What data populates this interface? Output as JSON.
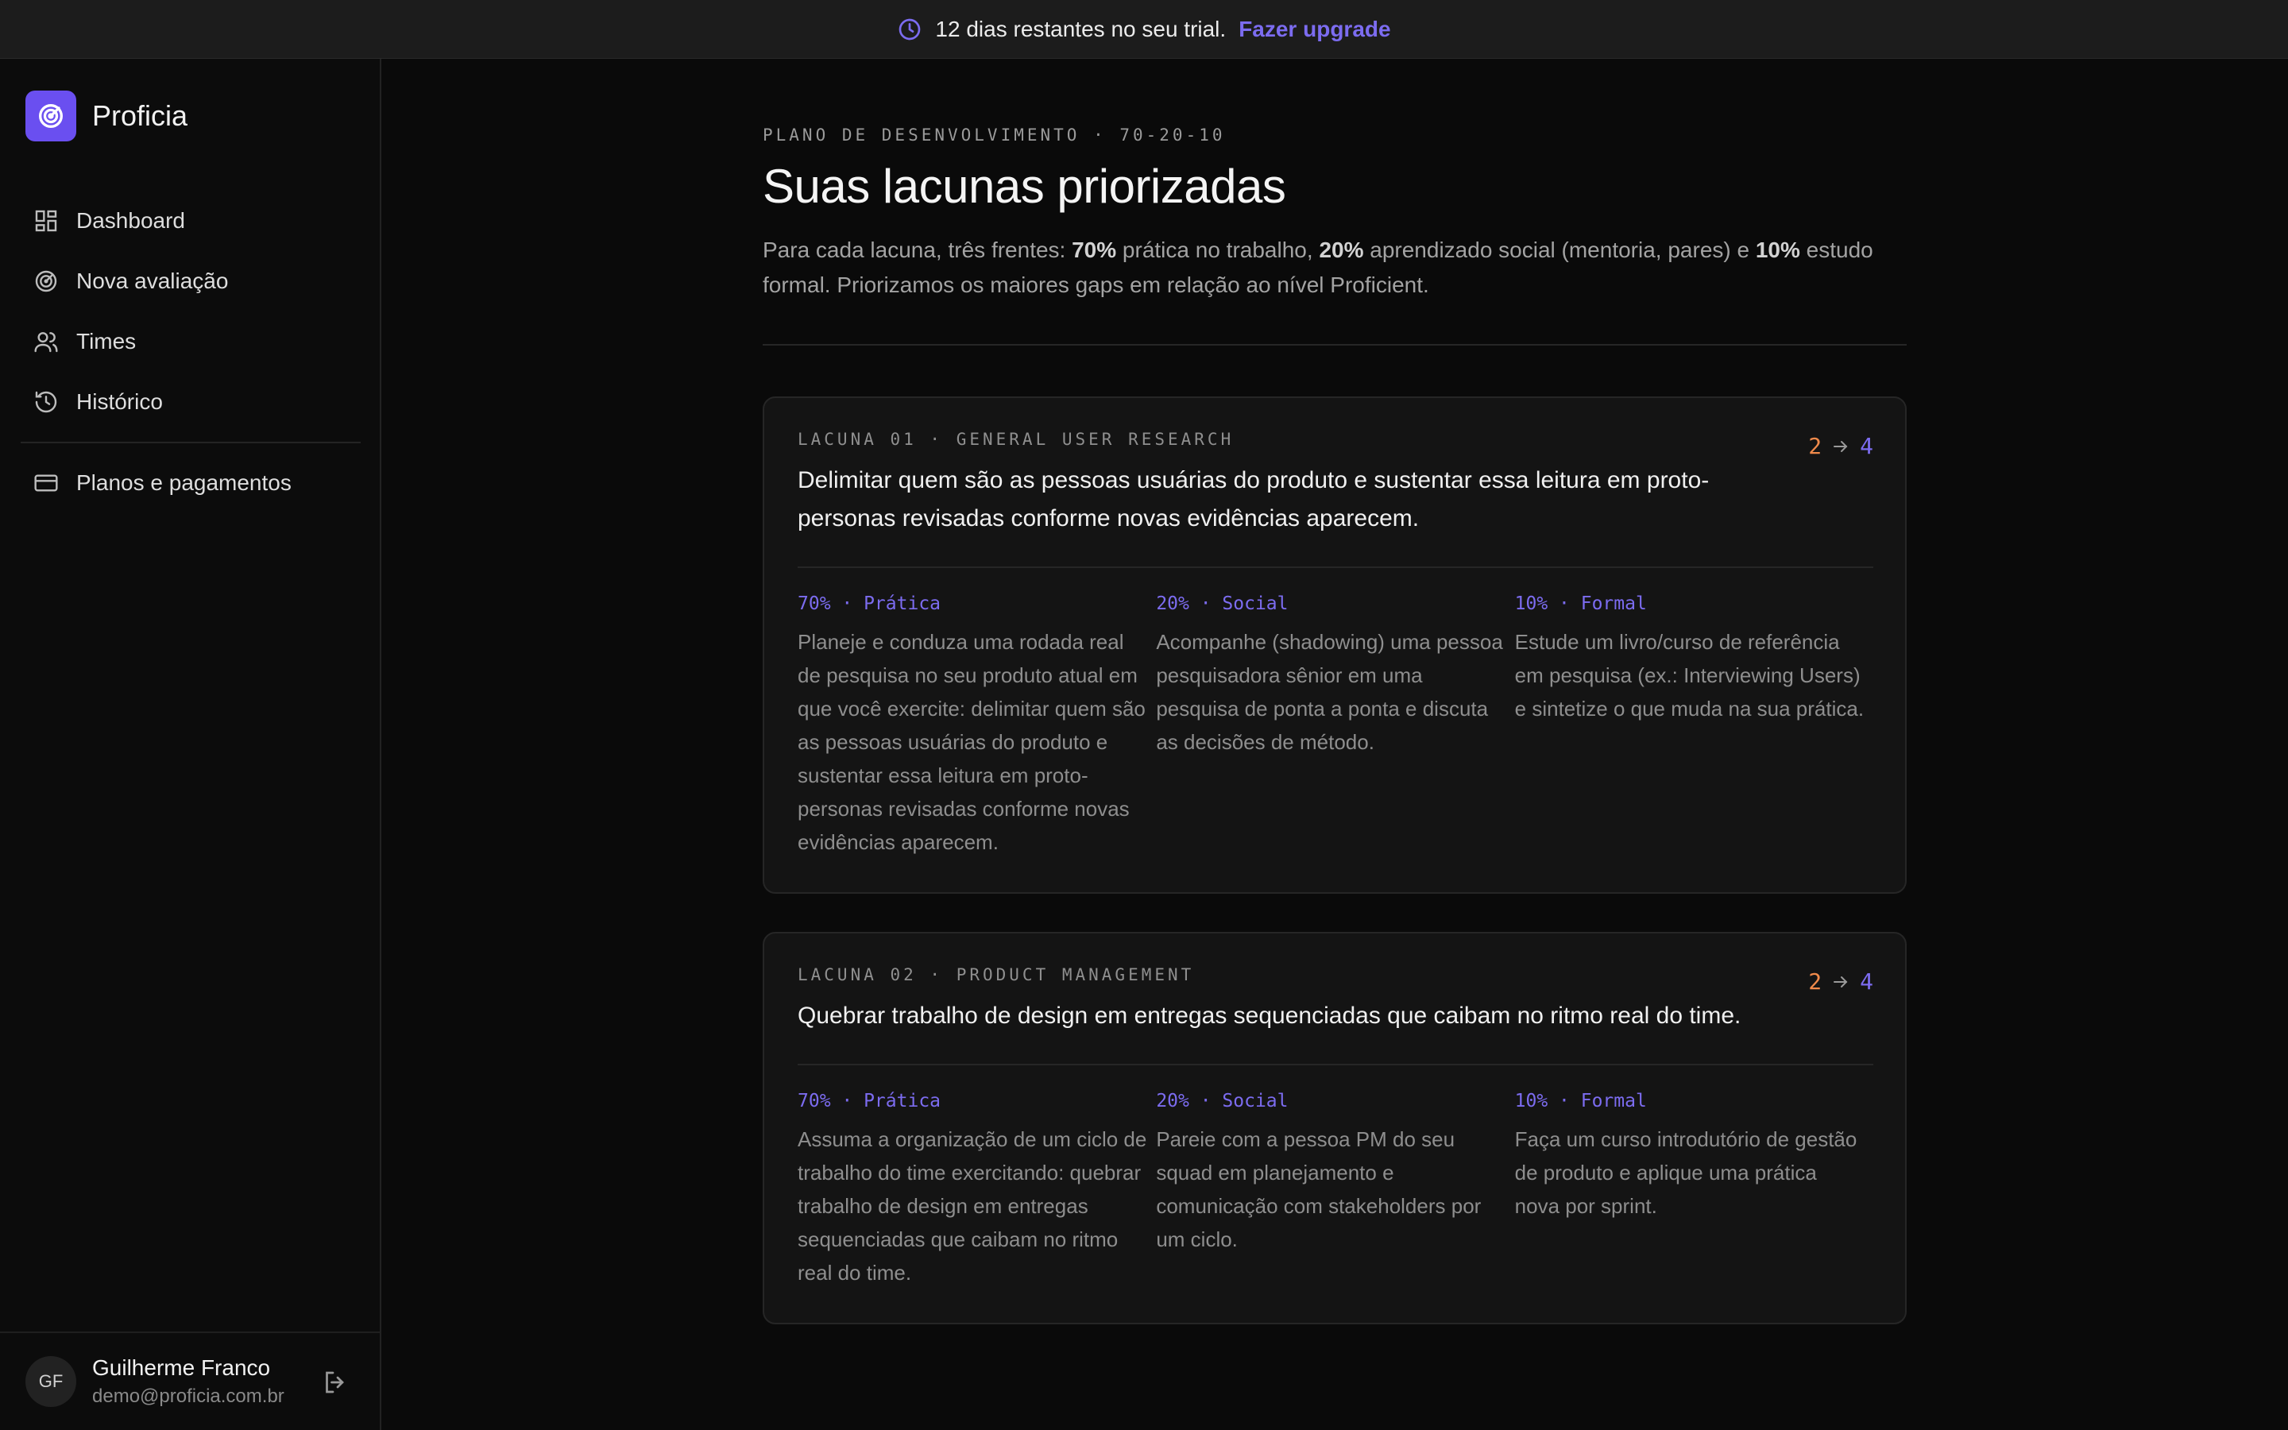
{
  "banner": {
    "message": "12 dias restantes no seu trial.",
    "upgrade_label": "Fazer upgrade"
  },
  "brand": {
    "name": "Proficia"
  },
  "nav": {
    "items": [
      {
        "label": "Dashboard",
        "icon": "dashboard-icon"
      },
      {
        "label": "Nova avaliação",
        "icon": "target-icon"
      },
      {
        "label": "Times",
        "icon": "users-icon"
      },
      {
        "label": "Histórico",
        "icon": "history-icon"
      }
    ],
    "secondary": {
      "label": "Planos e pagamentos",
      "icon": "credit-card-icon"
    }
  },
  "user": {
    "initials": "GF",
    "name": "Guilherme Franco",
    "email": "demo@proficia.com.br"
  },
  "page": {
    "eyebrow": "PLANO DE DESENVOLVIMENTO · 70-20-10",
    "title": "Suas lacunas priorizadas",
    "intro": {
      "p1": "Para cada lacuna, três frentes: ",
      "b1": "70%",
      "p2": " prática no trabalho, ",
      "b2": "20%",
      "p3": " aprendizado social (mentoria, pares) e ",
      "b3": "10%",
      "p4": " estudo formal. Priorizamos os maiores gaps em relação ao nível Proficient."
    }
  },
  "gaps": [
    {
      "label": "LACUNA 01 · GENERAL USER RESEARCH",
      "from": "2",
      "to": "4",
      "title": "Delimitar quem são as pessoas usuárias do produto e sustentar essa leitura em proto-personas revisadas conforme novas evidências aparecem.",
      "practice_head": "70% · Prática",
      "practice": "Planeje e conduza uma rodada real de pesquisa no seu produto atual em que você exercite: delimitar quem são as pessoas usuárias do produto e sustentar essa leitura em proto-personas revisadas conforme novas evidências aparecem.",
      "social_head": "20% · Social",
      "social": "Acompanhe (shadowing) uma pessoa pesquisadora sênior em uma pesquisa de ponta a ponta e discuta as decisões de método.",
      "formal_head": "10% · Formal",
      "formal": "Estude um livro/curso de referência em pesquisa (ex.: Interviewing Users) e sintetize o que muda na sua prática."
    },
    {
      "label": "LACUNA 02 · PRODUCT MANAGEMENT",
      "from": "2",
      "to": "4",
      "title": "Quebrar trabalho de design em entregas sequenciadas que caibam no ritmo real do time.",
      "practice_head": "70% · Prática",
      "practice": "Assuma a organização de um ciclo de trabalho do time exercitando: quebrar trabalho de design em entregas sequenciadas que caibam no ritmo real do time.",
      "social_head": "20% · Social",
      "social": "Pareie com a pessoa PM do seu squad em planejamento e comunicação com stakeholders por um ciclo.",
      "formal_head": "10% · Formal",
      "formal": "Faça um curso introdutório de gestão de produto e aplique uma prática nova por sprint."
    }
  ],
  "colors": {
    "accent": "#7c6cf0",
    "from_score": "#f08a4b",
    "background": "#0a0a0a",
    "card": "#141414"
  }
}
